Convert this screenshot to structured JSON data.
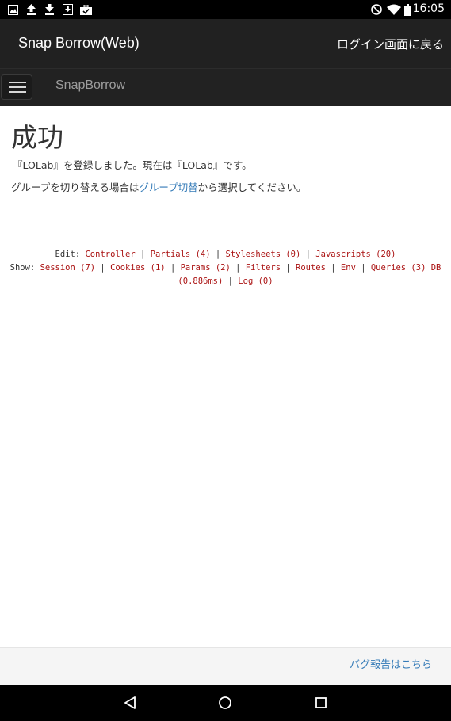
{
  "status_bar": {
    "time": "16:05",
    "left_icons": [
      "image-icon",
      "upload-icon",
      "download-icon",
      "download-box-icon",
      "briefcase-check-icon"
    ],
    "right_icons": [
      "do-not-disturb-icon",
      "wifi-icon",
      "battery-icon"
    ]
  },
  "app_bar": {
    "title": "Snap Borrow(Web)",
    "back_to_login": "ログイン画面に戻る"
  },
  "navbar": {
    "brand": "SnapBorrow"
  },
  "main": {
    "heading": "成功",
    "message": "『LOLab』を登録しました。現在は『LOLab』です。",
    "switch_text_before": "グループを切り替える場合は",
    "switch_link": "グループ切替",
    "switch_text_after": "から選択してください。"
  },
  "debug": {
    "edit_label": "Edit:",
    "edit_links": [
      "Controller",
      "Partials (4)",
      "Stylesheets (0)",
      "Javascripts (20)"
    ],
    "show_label": "Show:",
    "show_links": [
      "Session (7)",
      "Cookies (1)",
      "Params (2)",
      "Filters",
      "Routes",
      "Env",
      "Queries (3) DB (0.886ms)",
      "Log (0)"
    ]
  },
  "footer": {
    "bug_report": "バグ報告はこちら"
  },
  "system_nav": [
    "back-icon",
    "home-icon",
    "recents-icon"
  ]
}
